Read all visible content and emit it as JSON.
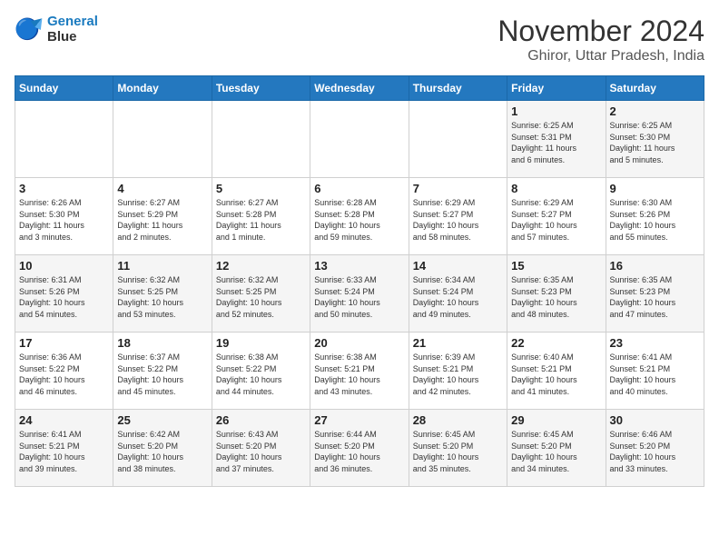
{
  "header": {
    "logo_line1": "General",
    "logo_line2": "Blue",
    "title": "November 2024",
    "subtitle": "Ghiror, Uttar Pradesh, India"
  },
  "days_of_week": [
    "Sunday",
    "Monday",
    "Tuesday",
    "Wednesday",
    "Thursday",
    "Friday",
    "Saturday"
  ],
  "weeks": [
    [
      {
        "day": "",
        "info": ""
      },
      {
        "day": "",
        "info": ""
      },
      {
        "day": "",
        "info": ""
      },
      {
        "day": "",
        "info": ""
      },
      {
        "day": "",
        "info": ""
      },
      {
        "day": "1",
        "info": "Sunrise: 6:25 AM\nSunset: 5:31 PM\nDaylight: 11 hours\nand 6 minutes."
      },
      {
        "day": "2",
        "info": "Sunrise: 6:25 AM\nSunset: 5:30 PM\nDaylight: 11 hours\nand 5 minutes."
      }
    ],
    [
      {
        "day": "3",
        "info": "Sunrise: 6:26 AM\nSunset: 5:30 PM\nDaylight: 11 hours\nand 3 minutes."
      },
      {
        "day": "4",
        "info": "Sunrise: 6:27 AM\nSunset: 5:29 PM\nDaylight: 11 hours\nand 2 minutes."
      },
      {
        "day": "5",
        "info": "Sunrise: 6:27 AM\nSunset: 5:28 PM\nDaylight: 11 hours\nand 1 minute."
      },
      {
        "day": "6",
        "info": "Sunrise: 6:28 AM\nSunset: 5:28 PM\nDaylight: 10 hours\nand 59 minutes."
      },
      {
        "day": "7",
        "info": "Sunrise: 6:29 AM\nSunset: 5:27 PM\nDaylight: 10 hours\nand 58 minutes."
      },
      {
        "day": "8",
        "info": "Sunrise: 6:29 AM\nSunset: 5:27 PM\nDaylight: 10 hours\nand 57 minutes."
      },
      {
        "day": "9",
        "info": "Sunrise: 6:30 AM\nSunset: 5:26 PM\nDaylight: 10 hours\nand 55 minutes."
      }
    ],
    [
      {
        "day": "10",
        "info": "Sunrise: 6:31 AM\nSunset: 5:26 PM\nDaylight: 10 hours\nand 54 minutes."
      },
      {
        "day": "11",
        "info": "Sunrise: 6:32 AM\nSunset: 5:25 PM\nDaylight: 10 hours\nand 53 minutes."
      },
      {
        "day": "12",
        "info": "Sunrise: 6:32 AM\nSunset: 5:25 PM\nDaylight: 10 hours\nand 52 minutes."
      },
      {
        "day": "13",
        "info": "Sunrise: 6:33 AM\nSunset: 5:24 PM\nDaylight: 10 hours\nand 50 minutes."
      },
      {
        "day": "14",
        "info": "Sunrise: 6:34 AM\nSunset: 5:24 PM\nDaylight: 10 hours\nand 49 minutes."
      },
      {
        "day": "15",
        "info": "Sunrise: 6:35 AM\nSunset: 5:23 PM\nDaylight: 10 hours\nand 48 minutes."
      },
      {
        "day": "16",
        "info": "Sunrise: 6:35 AM\nSunset: 5:23 PM\nDaylight: 10 hours\nand 47 minutes."
      }
    ],
    [
      {
        "day": "17",
        "info": "Sunrise: 6:36 AM\nSunset: 5:22 PM\nDaylight: 10 hours\nand 46 minutes."
      },
      {
        "day": "18",
        "info": "Sunrise: 6:37 AM\nSunset: 5:22 PM\nDaylight: 10 hours\nand 45 minutes."
      },
      {
        "day": "19",
        "info": "Sunrise: 6:38 AM\nSunset: 5:22 PM\nDaylight: 10 hours\nand 44 minutes."
      },
      {
        "day": "20",
        "info": "Sunrise: 6:38 AM\nSunset: 5:21 PM\nDaylight: 10 hours\nand 43 minutes."
      },
      {
        "day": "21",
        "info": "Sunrise: 6:39 AM\nSunset: 5:21 PM\nDaylight: 10 hours\nand 42 minutes."
      },
      {
        "day": "22",
        "info": "Sunrise: 6:40 AM\nSunset: 5:21 PM\nDaylight: 10 hours\nand 41 minutes."
      },
      {
        "day": "23",
        "info": "Sunrise: 6:41 AM\nSunset: 5:21 PM\nDaylight: 10 hours\nand 40 minutes."
      }
    ],
    [
      {
        "day": "24",
        "info": "Sunrise: 6:41 AM\nSunset: 5:21 PM\nDaylight: 10 hours\nand 39 minutes."
      },
      {
        "day": "25",
        "info": "Sunrise: 6:42 AM\nSunset: 5:20 PM\nDaylight: 10 hours\nand 38 minutes."
      },
      {
        "day": "26",
        "info": "Sunrise: 6:43 AM\nSunset: 5:20 PM\nDaylight: 10 hours\nand 37 minutes."
      },
      {
        "day": "27",
        "info": "Sunrise: 6:44 AM\nSunset: 5:20 PM\nDaylight: 10 hours\nand 36 minutes."
      },
      {
        "day": "28",
        "info": "Sunrise: 6:45 AM\nSunset: 5:20 PM\nDaylight: 10 hours\nand 35 minutes."
      },
      {
        "day": "29",
        "info": "Sunrise: 6:45 AM\nSunset: 5:20 PM\nDaylight: 10 hours\nand 34 minutes."
      },
      {
        "day": "30",
        "info": "Sunrise: 6:46 AM\nSunset: 5:20 PM\nDaylight: 10 hours\nand 33 minutes."
      }
    ]
  ]
}
